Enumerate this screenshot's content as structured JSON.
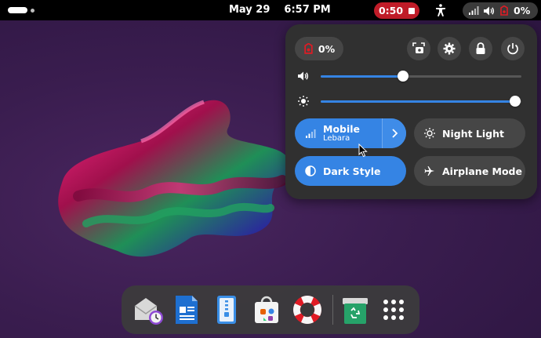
{
  "topbar": {
    "date": "May 29",
    "time": "6:57 PM",
    "recording_time": "0:50",
    "battery_percent": "0%"
  },
  "quick_settings": {
    "battery_percent": "0%",
    "volume_level": 0.41,
    "brightness_level": 0.97,
    "tiles": {
      "mobile_label": "Mobile",
      "mobile_sublabel": "Lebara",
      "night_light_label": "Night Light",
      "dark_style_label": "Dark Style",
      "airplane_label": "Airplane Mode"
    }
  },
  "colors": {
    "accent": "#3584e4",
    "recording": "#c01c28",
    "panel": "#303030",
    "button": "#464646"
  },
  "dock": {
    "apps": [
      "mail-clock-icon",
      "writer-icon",
      "archive-icon",
      "software-store-icon",
      "help-icon",
      "trash-icon",
      "app-grid-icon"
    ]
  }
}
